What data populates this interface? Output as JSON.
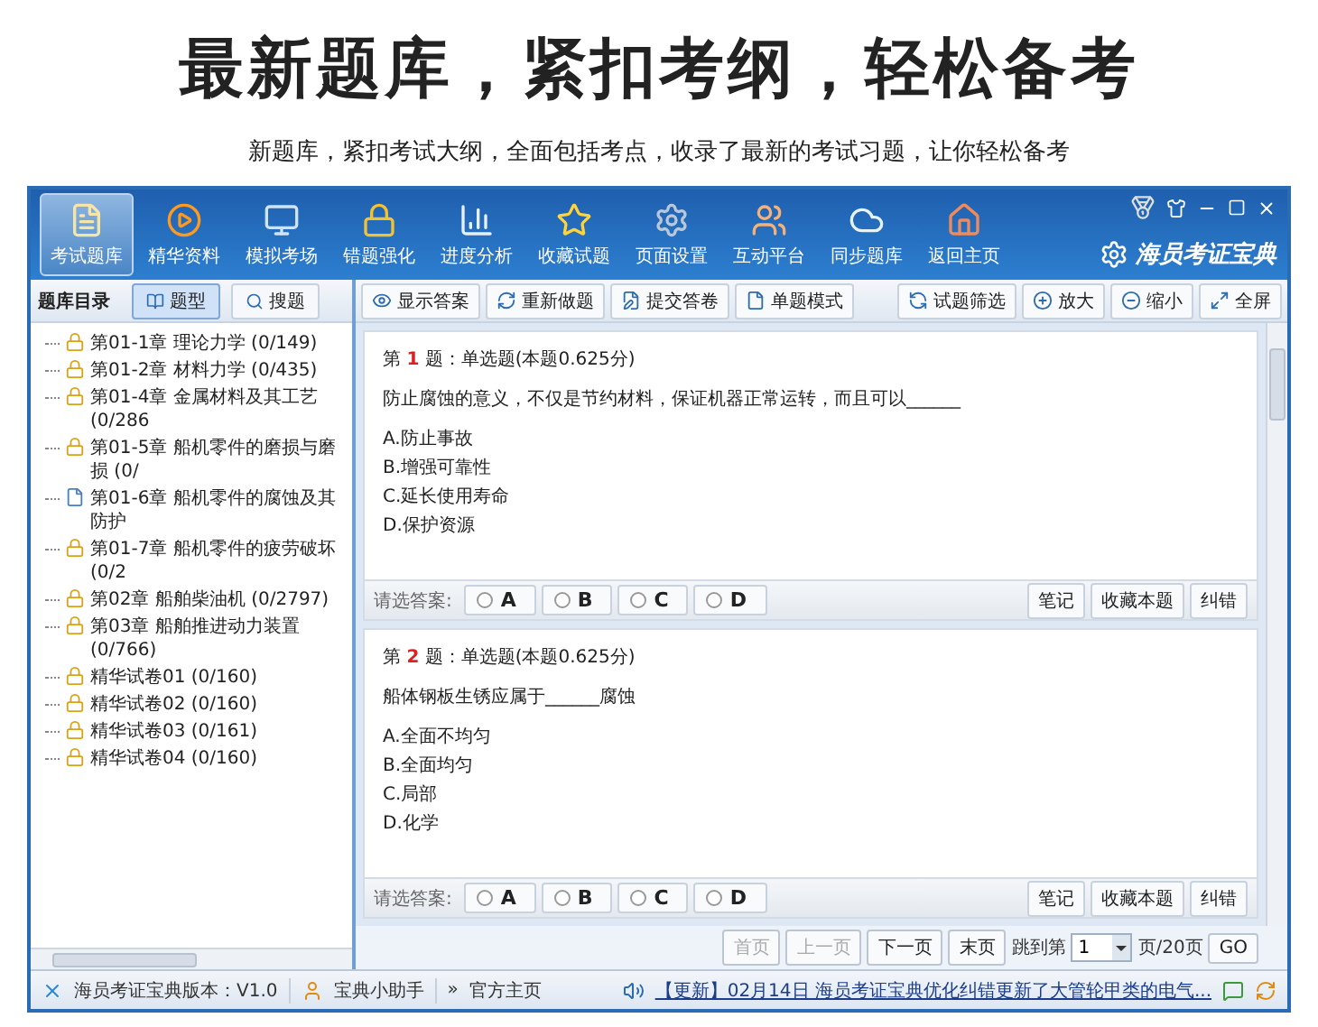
{
  "headline": "最新题库，紧扣考纲，轻松备考",
  "subheadline": "新题库，紧扣考试大纲，全面包括考点，收录了最新的考试习题，让你轻松备考",
  "app": {
    "nav": [
      {
        "label": "考试题库",
        "selected": true
      },
      {
        "label": "精华资料",
        "selected": false
      },
      {
        "label": "模拟考场",
        "selected": false
      },
      {
        "label": "错题强化",
        "selected": false
      },
      {
        "label": "进度分析",
        "selected": false
      },
      {
        "label": "收藏试题",
        "selected": false
      },
      {
        "label": "页面设置",
        "selected": false
      },
      {
        "label": "互动平台",
        "selected": false
      },
      {
        "label": "同步题库",
        "selected": false
      },
      {
        "label": "返回主页",
        "selected": false
      }
    ],
    "logo": "海员考证宝典",
    "sidebar": {
      "title": "题库目录",
      "tabs": [
        {
          "label": "题型",
          "selected": true
        },
        {
          "label": "搜题",
          "selected": false
        }
      ],
      "items": [
        {
          "label": "第01-1章 理论力学 (0/149)",
          "kind": "locked"
        },
        {
          "label": "第01-2章 材料力学 (0/435)",
          "kind": "locked"
        },
        {
          "label": "第01-4章 金属材料及其工艺 (0/286",
          "kind": "locked"
        },
        {
          "label": "第01-5章 船机零件的磨损与磨损 (0/",
          "kind": "locked"
        },
        {
          "label": "第01-6章 船机零件的腐蚀及其防护",
          "kind": "open"
        },
        {
          "label": "第01-7章 船机零件的疲劳破坏 (0/2",
          "kind": "locked"
        },
        {
          "label": "第02章 船舶柴油机 (0/2797)",
          "kind": "locked"
        },
        {
          "label": "第03章 船舶推进动力装置 (0/766)",
          "kind": "locked"
        },
        {
          "label": "精华试卷01 (0/160)",
          "kind": "locked"
        },
        {
          "label": "精华试卷02 (0/160)",
          "kind": "locked"
        },
        {
          "label": "精华试卷03 (0/161)",
          "kind": "locked"
        },
        {
          "label": "精华试卷04 (0/160)",
          "kind": "locked"
        }
      ]
    },
    "toolbar_left": [
      "显示答案",
      "重新做题",
      "提交答卷",
      "单题模式"
    ],
    "toolbar_right": [
      "试题筛选",
      "放大",
      "缩小",
      "全屏"
    ],
    "questions": [
      {
        "prefix": "第",
        "number": "1",
        "suffix": "题：单选题(本题0.625分)",
        "stem": "防止腐蚀的意义，不仅是节约材料，保证机器正常运转，而且可以______",
        "options": [
          "A.防止事故",
          "B.增强可靠性",
          "C.延长使用寿命",
          "D.保护资源"
        ],
        "answer_label": "请选答案:",
        "choices": [
          {
            "label": "A",
            "selected": false
          },
          {
            "label": "B",
            "selected": false
          },
          {
            "label": "C",
            "selected": false
          },
          {
            "label": "D",
            "selected": false
          }
        ],
        "actions": [
          "笔记",
          "收藏本题",
          "纠错"
        ]
      },
      {
        "prefix": "第",
        "number": "2",
        "suffix": "题：单选题(本题0.625分)",
        "stem": "船体钢板生锈应属于______腐蚀",
        "options": [
          "A.全面不均匀",
          "B.全面均匀",
          "C.局部",
          "D.化学"
        ],
        "answer_label": "请选答案:",
        "choices": [
          {
            "label": "A",
            "selected": false
          },
          {
            "label": "B",
            "selected": false
          },
          {
            "label": "C",
            "selected": false
          },
          {
            "label": "D",
            "selected": false
          }
        ],
        "actions": [
          "笔记",
          "收藏本题",
          "纠错"
        ]
      }
    ],
    "pager": {
      "buttons": [
        {
          "label": "首页",
          "disabled": true
        },
        {
          "label": "上一页",
          "disabled": true
        },
        {
          "label": "下一页",
          "disabled": false
        },
        {
          "label": "末页",
          "disabled": false
        }
      ],
      "jump_label": "跳到第",
      "page": "1",
      "total": "页/20页",
      "go": "GO"
    },
    "status": {
      "version": "海员考证宝典版本：V1.0",
      "helper": "宝典小助手",
      "arrows": "»",
      "home": "官方主页",
      "news": "【更新】02月14日 海员考证宝典优化纠错更新了大管轮甲类的电气..."
    }
  }
}
